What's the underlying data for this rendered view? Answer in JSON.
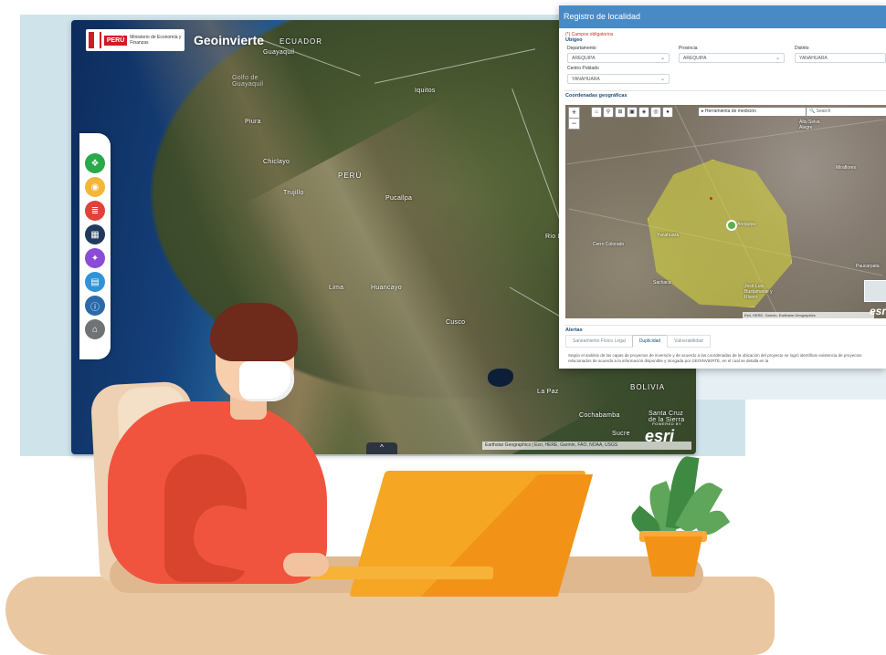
{
  "colors": {
    "dialog_header": "#4a8ac4",
    "tool_green": "#2aa84a",
    "tool_yellow": "#f4b63a",
    "tool_red": "#e0413b",
    "tool_navy": "#1f3a5c",
    "tool_purple": "#8c4bd6",
    "tool_blue": "#2f93d6",
    "tool_darkblue": "#2a6aa8",
    "tool_gray": "#6f7376",
    "buffer_fill": "#d6d63c"
  },
  "header": {
    "gov_brand": "PERÚ",
    "gov_ministry": "Ministerio de Economía y Finanzas",
    "app_title": "Geoinvierte"
  },
  "toolbar": {
    "icons": [
      "layers-icon",
      "money-icon",
      "stack-icon",
      "grid-icon",
      "chart-icon",
      "print-icon",
      "info-icon",
      "lock-icon"
    ]
  },
  "map": {
    "labels": {
      "ecuador": "ECUADOR",
      "guayaquil": "Guayaquil",
      "golfo": "Golfo de Guayaquil",
      "iquitos": "Iquitos",
      "piura": "Piura",
      "chiclayo": "Chiclayo",
      "peru": "PERÚ",
      "trujillo": "Trujillo",
      "pucallpa": "Pucallpa",
      "lima": "Lima",
      "huancayo": "Huancayo",
      "cusco": "Cusco",
      "bolivia": "BOLIVIA",
      "la_paz": "La Paz",
      "cochabamba": "Cochabamba",
      "santa_cruz": "Santa Cruz de la Sierra",
      "sucre": "Sucre",
      "rio_branco": "Rio Bra"
    },
    "attribution": "Earthstar Geographics | Esri, HERE, Garmin, FAO, NOAA, USGS",
    "esri_powered": "POWERED BY",
    "esri": "esri",
    "bottom_tab": "^"
  },
  "dialog": {
    "title": "Registro de localidad",
    "note": "(*) Campos obligatorios",
    "ubigeo": "Ubigeo",
    "departamento_label": "Departamento",
    "departamento_value": "AREQUIPA",
    "provincia_label": "Provincia",
    "provincia_value": "AREQUIPA",
    "distrito_label": "Distrito",
    "distrito_value": "YANAHUARA",
    "centro_label": "Centro Poblado",
    "centro_value": "YANAHUARA",
    "coords_label": "Coordenadas geográficas",
    "zoom_in": "+",
    "zoom_out": "−",
    "measure": "▸ Herramienta de medición",
    "search": "🔍 Search",
    "sat_labels": {
      "arequipa": "Arequipa",
      "alto_selva": "Alto Selva Alegre",
      "miraflores": "Miraflores",
      "yanahuara": "Yanahuara",
      "cerro": "Cerro Colorado",
      "paucarpata": "Paucarpata",
      "jose_luis": "José Luis Bustamante y Rivero",
      "sachaca": "Sachaca"
    },
    "sat_attribution": "Esri, HERE, Garmin, Earthstar Geographics",
    "alertas": "Alertas",
    "tabs": [
      "Saneamiento Físico Legal",
      "Duplicidad",
      "Vulnerabilidad"
    ],
    "description": "Según el análisis de las capas de proyectos de inversión y de acuerdo a las coordenadas de la ubicación del proyecto se logró identificar existencia de proyectos relacionados de acuerdo a la información disponible y otorgada por GEOINVIERTE, en el cual se detalla en la"
  }
}
